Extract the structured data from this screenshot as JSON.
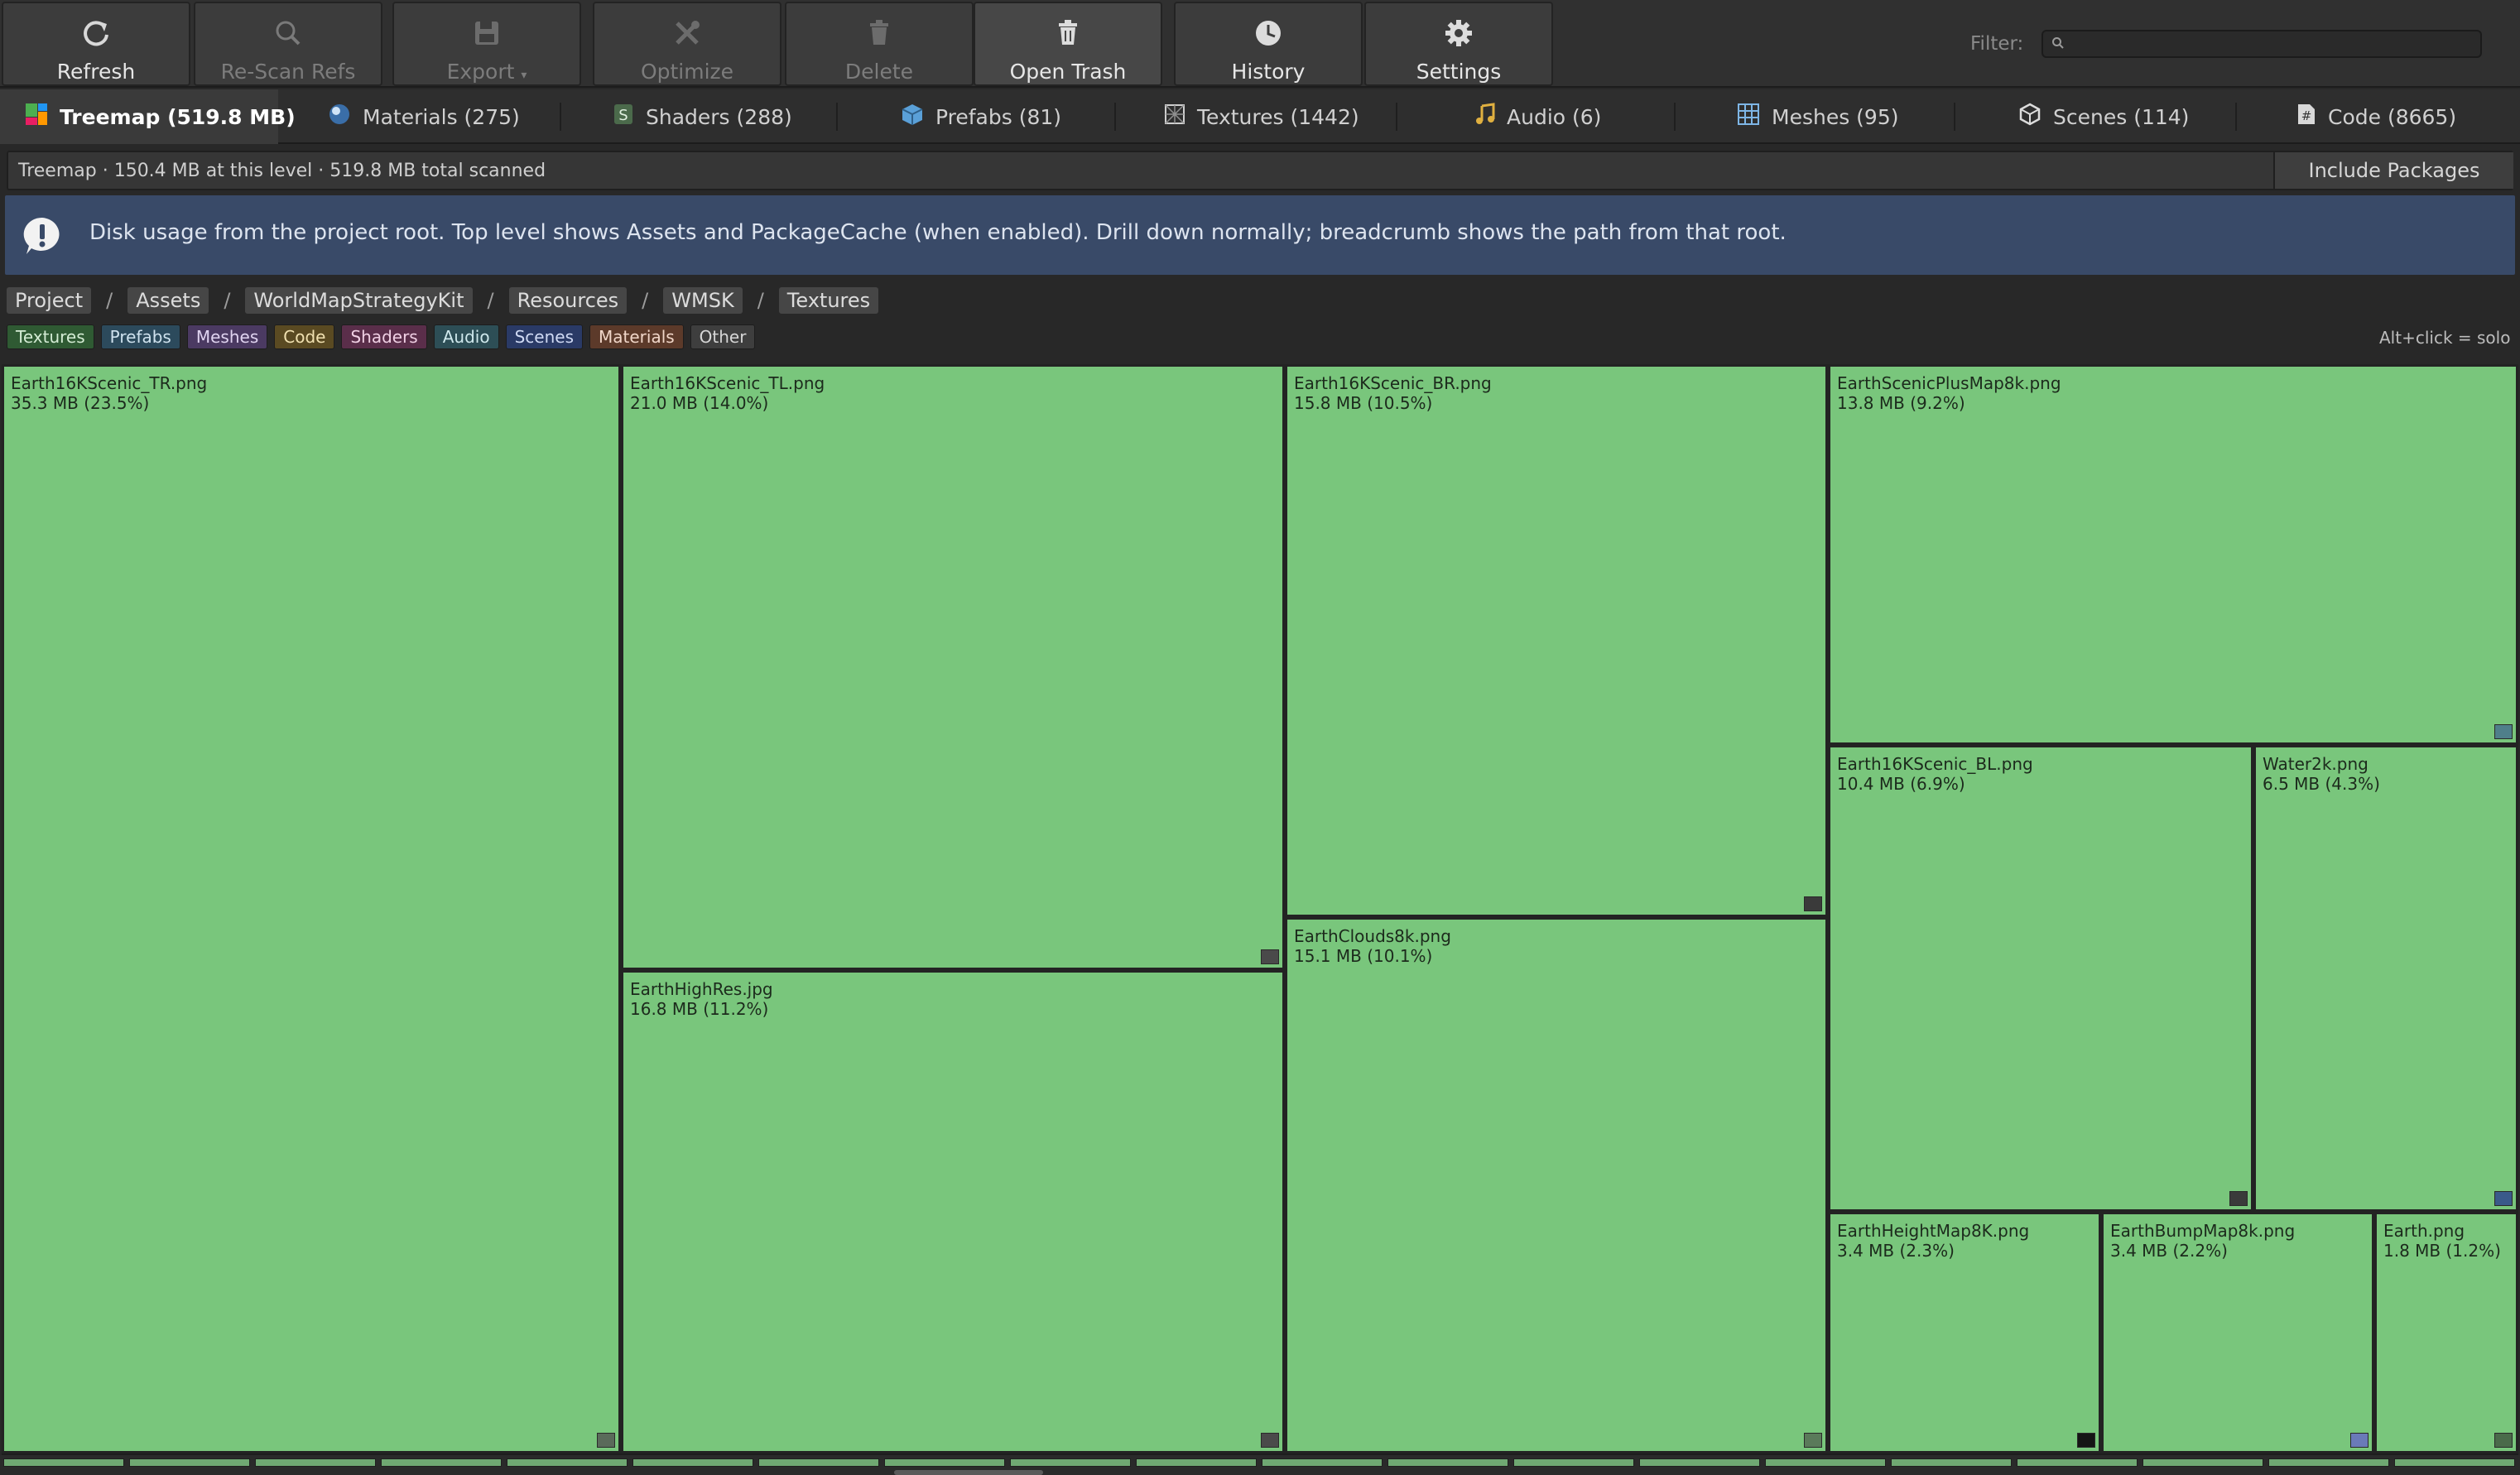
{
  "toolbar": {
    "buttons": [
      {
        "label": "Refresh",
        "icon": "refresh-icon",
        "enabled": true
      },
      {
        "label": "Re-Scan Refs",
        "icon": "search-icon",
        "enabled": false
      },
      {
        "label": "Export",
        "icon": "save-icon",
        "enabled": false
      },
      {
        "label": "Optimize",
        "icon": "tools-icon",
        "enabled": false
      },
      {
        "label": "Delete",
        "icon": "trash-icon",
        "enabled": false
      },
      {
        "label": "Open Trash",
        "icon": "trash-icon",
        "enabled": true
      },
      {
        "label": "History",
        "icon": "clock-icon",
        "enabled": true
      },
      {
        "label": "Settings",
        "icon": "gear-icon",
        "enabled": true
      }
    ],
    "filter_label": "Filter:",
    "filter_value": ""
  },
  "tabs": [
    {
      "label": "Treemap (519.8 MB)",
      "icon": "treemap-icon",
      "active": true
    },
    {
      "label": "Materials (275)",
      "icon": "material-sphere-icon"
    },
    {
      "label": "Shaders (288)",
      "icon": "shader-icon"
    },
    {
      "label": "Prefabs (81)",
      "icon": "prefab-cube-icon"
    },
    {
      "label": "Textures (1442)",
      "icon": "texture-icon"
    },
    {
      "label": "Audio (6)",
      "icon": "music-note-icon"
    },
    {
      "label": "Meshes (95)",
      "icon": "mesh-grid-icon"
    },
    {
      "label": "Scenes (114)",
      "icon": "scene-icon"
    },
    {
      "label": "Code (8665)",
      "icon": "code-file-icon"
    }
  ],
  "status": {
    "text": "Treemap  ·  150.4 MB at this level  ·  519.8 MB total scanned",
    "include_packages_label": "Include Packages"
  },
  "banner": {
    "text": "Disk usage from the project root. Top level shows Assets and PackageCache (when enabled). Drill down normally; breadcrumb shows the path from that root.",
    "icon": "exclamation-icon"
  },
  "breadcrumb": [
    "Project",
    "Assets",
    "WorldMapStrategyKit",
    "Resources",
    "WMSK",
    "Textures"
  ],
  "breadcrumb_separator": "/",
  "legend": {
    "items": [
      {
        "label": "Textures",
        "color": "#2f5a33",
        "text_color": "#d4ecd4"
      },
      {
        "label": "Prefabs",
        "color": "#2c4a5c",
        "text_color": "#cfe2ee"
      },
      {
        "label": "Meshes",
        "color": "#4b3a62",
        "text_color": "#e0d4f0"
      },
      {
        "label": "Code",
        "color": "#5a4a22",
        "text_color": "#f0e0b0"
      },
      {
        "label": "Shaders",
        "color": "#5a2e4a",
        "text_color": "#f0d0e4"
      },
      {
        "label": "Audio",
        "color": "#2d4e56",
        "text_color": "#cfe8ec"
      },
      {
        "label": "Scenes",
        "color": "#2a3a66",
        "text_color": "#d0daf4"
      },
      {
        "label": "Materials",
        "color": "#5c3a2a",
        "text_color": "#f0d6c8"
      },
      {
        "label": "Other",
        "color": "#3e3e3e",
        "text_color": "#d6d6d6"
      }
    ],
    "hint": "Alt+click = solo"
  },
  "treemap": {
    "tile_color": "#79c67c",
    "tiles": [
      {
        "name": "Earth16KScenic_TR.png",
        "size": "35.3 MB (23.5%)",
        "thumb": "#5a6a5a"
      },
      {
        "name": "Earth16KScenic_TL.png",
        "size": "21.0 MB (14.0%)",
        "thumb": "#4a4a4a"
      },
      {
        "name": "EarthHighRes.jpg",
        "size": "16.8 MB (11.2%)",
        "thumb": "#4a4a4a"
      },
      {
        "name": "Earth16KScenic_BR.png",
        "size": "15.8 MB (10.5%)",
        "thumb": "#3a3a3a"
      },
      {
        "name": "EarthClouds8k.png",
        "size": "15.1 MB (10.1%)",
        "thumb": "#5a7a5a"
      },
      {
        "name": "EarthScenicPlusMap8k.png",
        "size": "13.8 MB (9.2%)",
        "thumb": "#4f7f8a"
      },
      {
        "name": "Earth16KScenic_BL.png",
        "size": "10.4 MB (6.9%)",
        "thumb": "#3a3a3a"
      },
      {
        "name": "Water2k.png",
        "size": "6.5 MB (4.3%)",
        "thumb": "#3a5a8a"
      },
      {
        "name": "EarthHeightMap8K.png",
        "size": "3.4 MB (2.3%)",
        "thumb": "#151515"
      },
      {
        "name": "EarthBumpMap8k.png",
        "size": "3.4 MB (2.2%)",
        "thumb": "#6a7ab8"
      },
      {
        "name": "Earth.png",
        "size": "1.8 MB (1.2%)",
        "thumb": "#4a6a4a"
      }
    ]
  }
}
